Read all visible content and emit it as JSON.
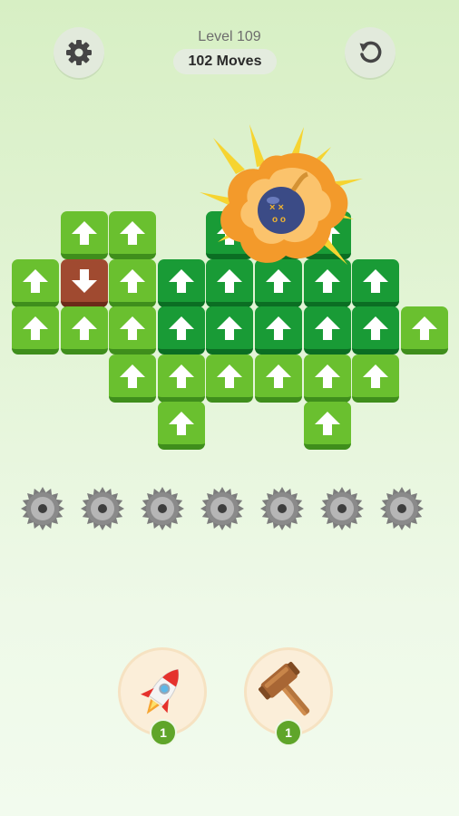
{
  "header": {
    "level_label": "Level 109",
    "moves_label": "102 Moves"
  },
  "board": {
    "tile_colors": {
      "light": "#6ac02f",
      "dark": "#199b36",
      "blocked": "#a04a30"
    },
    "rows": [
      [
        null,
        "light-up",
        "light-up",
        null,
        "dark-up",
        "dark-up",
        "dark-up",
        null,
        null
      ],
      [
        "light-up",
        "brown-down",
        "light-up",
        "dark-up",
        "dark-up",
        "dark-up",
        "dark-up",
        "dark-up",
        null
      ],
      [
        "light-up",
        "light-up",
        "light-up",
        "dark-up",
        "dark-up",
        "dark-up",
        "dark-up",
        "dark-up",
        "light-up"
      ],
      [
        null,
        null,
        "light-up",
        "light-up",
        "light-up",
        "light-up",
        "light-up",
        "light-up",
        null
      ],
      [
        null,
        null,
        null,
        "light-up",
        null,
        null,
        "light-up",
        null,
        null
      ]
    ],
    "bomb_effect": "explosion",
    "saw_blades": 7
  },
  "boosters": [
    {
      "icon": "rocket-icon",
      "count": "1"
    },
    {
      "icon": "hammer-icon",
      "count": "1"
    }
  ]
}
